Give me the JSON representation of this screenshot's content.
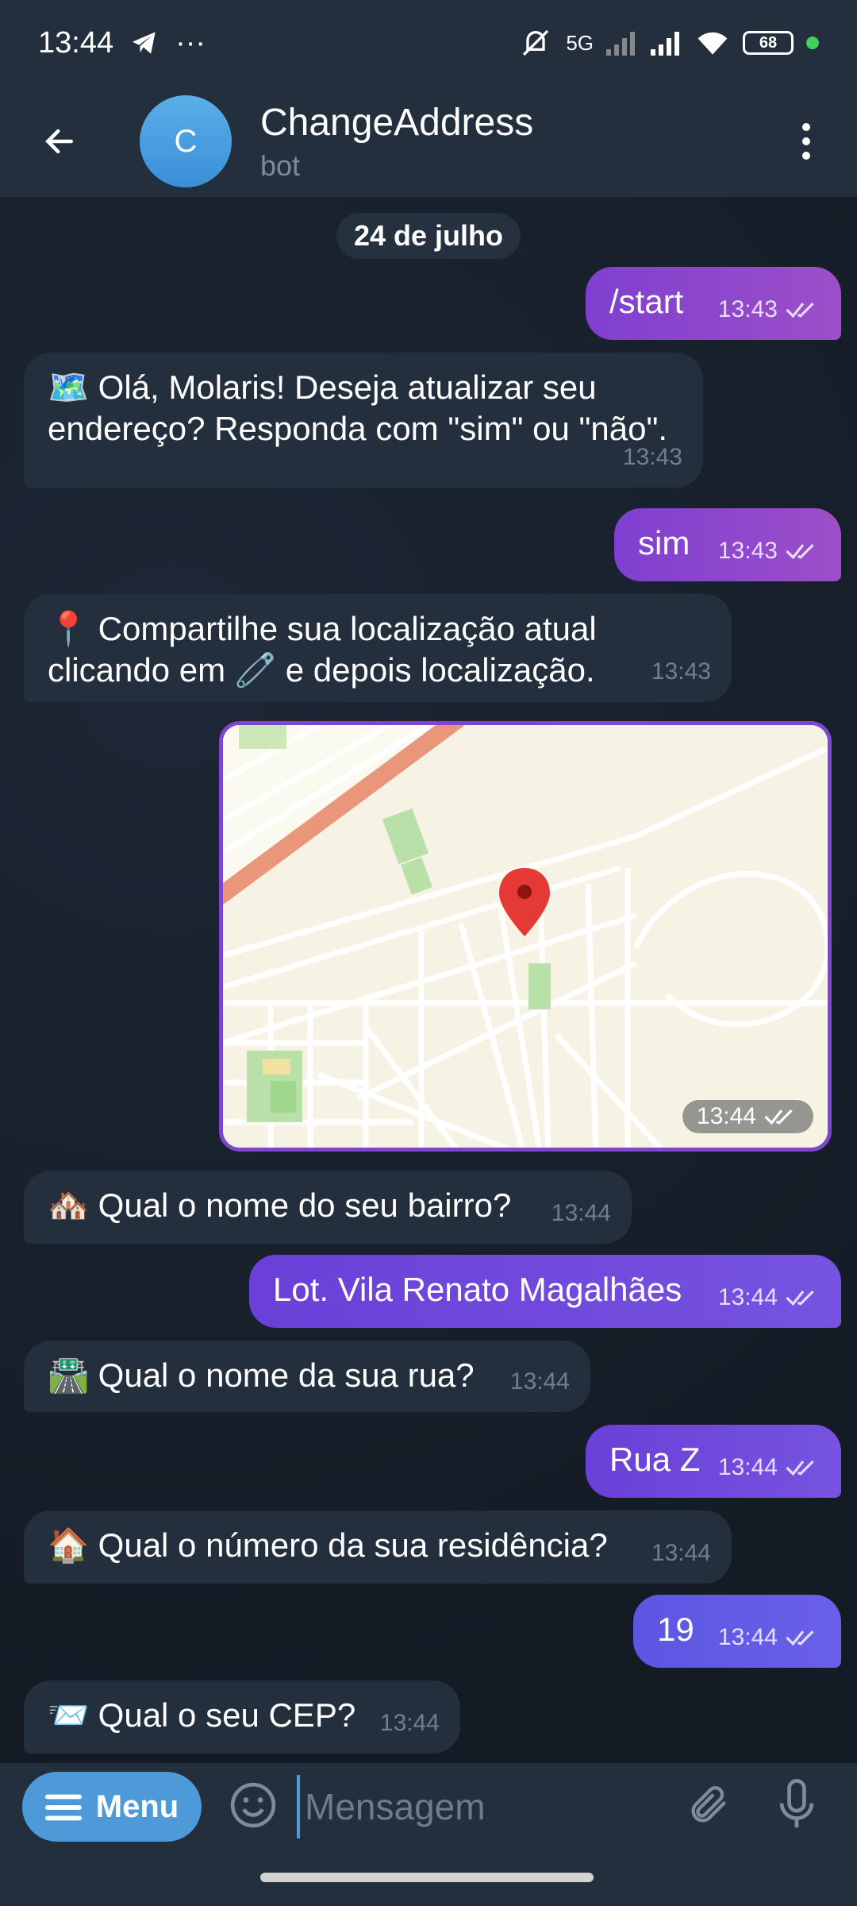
{
  "status_bar": {
    "time": "13:44",
    "network": "5G",
    "battery": "68"
  },
  "header": {
    "avatar_letter": "C",
    "title": "ChangeAddress",
    "subtitle": "bot"
  },
  "date_chip": "24 de julho",
  "messages": [
    {
      "dir": "out",
      "text": "/start",
      "time": "13:43"
    },
    {
      "dir": "in",
      "emoji": "🗺️",
      "line1": "Olá, Molaris! Deseja atualizar seu",
      "line2": "endereço? Responda com \"sim\" ou \"não\".",
      "time": "13:43"
    },
    {
      "dir": "out",
      "text": "sim",
      "time": "13:43"
    },
    {
      "dir": "in",
      "emoji": "📍",
      "line1": "Compartilhe sua localização atual",
      "line2": "clicando em 🧷 e depois localização.",
      "time": "13:43"
    },
    {
      "dir": "out",
      "type": "location",
      "time": "13:44"
    },
    {
      "dir": "in",
      "emoji": "🏘️",
      "text": "Qual o nome do seu bairro?",
      "time": "13:44"
    },
    {
      "dir": "out",
      "text": "Lot. Vila Renato Magalhães",
      "time": "13:44"
    },
    {
      "dir": "in",
      "emoji": "🛣️",
      "text": "Qual o nome da sua rua?",
      "time": "13:44"
    },
    {
      "dir": "out",
      "text": "Rua Z",
      "time": "13:44"
    },
    {
      "dir": "in",
      "emoji": "🏠",
      "text": "Qual o número da sua residência?",
      "time": "13:44"
    },
    {
      "dir": "out",
      "text": "19",
      "time": "13:44"
    },
    {
      "dir": "in",
      "emoji": "📨",
      "text": "Qual o seu CEP?",
      "time": "13:44"
    }
  ],
  "input_bar": {
    "menu_label": "Menu",
    "placeholder": "Mensagem"
  },
  "colors": {
    "header_bg": "#242f3d",
    "incoming_bubble": "#242f3d",
    "outgoing_bubble": "#8a45cf",
    "accent": "#4e9ad8"
  },
  "icons": [
    "back-arrow-icon",
    "kebab-menu-icon",
    "double-check-icon",
    "map-pin-icon",
    "hamburger-icon",
    "smiley-icon",
    "paperclip-icon",
    "microphone-icon"
  ]
}
